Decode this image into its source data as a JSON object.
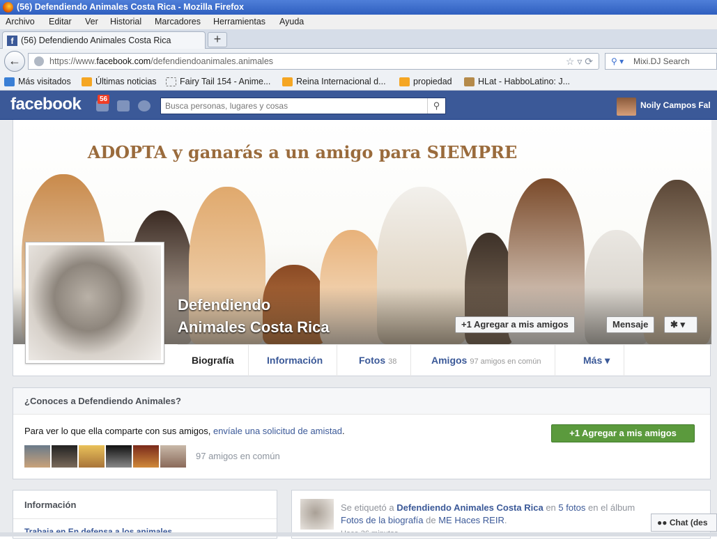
{
  "window": {
    "title": "(56) Defendiendo Animales Costa Rica - Mozilla Firefox"
  },
  "menu": [
    "Archivo",
    "Editar",
    "Ver",
    "Historial",
    "Marcadores",
    "Herramientas",
    "Ayuda"
  ],
  "tab": {
    "title": "(56) Defendiendo Animales Costa Rica",
    "new_tab": "+"
  },
  "navbar": {
    "url_prefix": "https://www.",
    "url_domain": "facebook.com",
    "url_path": "/defendiendoanimales.animales",
    "search_placeholder": "Mixi.DJ Search"
  },
  "bookmarks": [
    "Más visitados",
    "Últimas noticias",
    "Fairy Tail 154 - Anime...",
    "Reina Internacional d...",
    "propiedad",
    "HLat - HabboLatino: J..."
  ],
  "facebook": {
    "logo": "facebook",
    "notifications": "56",
    "search_placeholder": "Busca personas, lugares y cosas",
    "user_name": "Noily Campos Fal"
  },
  "cover": {
    "slogan": "ADOPTA y ganarás a un amigo para SIEMPRE",
    "page_name_line1": "Defendiendo",
    "page_name_line2": "Animales Costa Rica",
    "add_friend": "+1 Agregar a mis amigos",
    "message": "Mensaje",
    "settings": "✱ ▾"
  },
  "tabs": {
    "biografia": "Biografía",
    "informacion": "Información",
    "fotos": "Fotos",
    "fotos_count": "38",
    "amigos": "Amigos",
    "amigos_note": "97 amigos en común",
    "mas": "Más ▾"
  },
  "know_box": {
    "title": "¿Conoces a Defendiendo Animales?",
    "text_before": "Para ver lo que ella comparte con sus amigos, ",
    "link": "envíale una solicitud de amistad",
    "text_after": ".",
    "add_button": "+1 Agregar a mis amigos",
    "mutual": "97 amigos en común"
  },
  "info_box": {
    "title": "Información",
    "work": "Trabaja en En defensa a los animales"
  },
  "post": {
    "line1_a": "Se etiquetó a ",
    "line1_page": "Defendiendo Animales Costa Rica",
    "line1_b": " en ",
    "line1_photos": "5 fotos",
    "line1_c": " en el álbum",
    "line2_album": "Fotos de la biografía",
    "line2_b": " de ",
    "line2_owner": "ME Haces REIR",
    "line2_c": ".",
    "time": "Hace 36 minutos"
  },
  "chat": "Chat (des",
  "colors": {
    "facebook_blue": "#3b5998",
    "green_button": "#5b9a3d",
    "notification_red": "#f03d25"
  }
}
